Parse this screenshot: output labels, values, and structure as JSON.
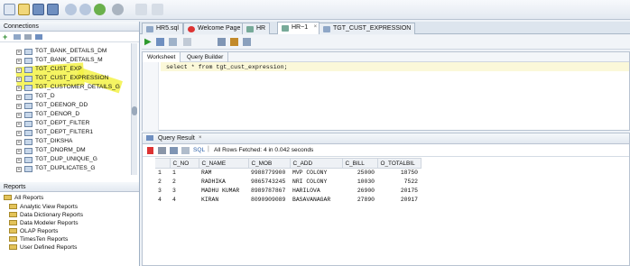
{
  "toolbar": {
    "icons": [
      "new-icon",
      "open-icon",
      "save-icon",
      "save-all-icon",
      "undo-icon",
      "redo-icon",
      "back-icon",
      "forward-icon",
      "run-icon",
      "debug-icon"
    ]
  },
  "tabs": [
    {
      "label": "HR5.sql",
      "color": "#8fa7c7"
    },
    {
      "label": "Welcome Page",
      "color": "#d33"
    },
    {
      "label": "HR",
      "color": "#7a9"
    },
    {
      "label": "HR~1",
      "color": "#7a9"
    },
    {
      "label": "TGT_CUST_EXPRESSION",
      "color": "#8fa7c7"
    }
  ],
  "connections": {
    "title": "Connections",
    "items": [
      "TGT_BANK_DETAILS_DM",
      "TGT_BANK_DETAILS_M",
      "TGT_CUST_EXP",
      "TGT_CUST_EXPRESSION",
      "TGT_CUSTOMER_DETAILS_G",
      "TGT_D",
      "TGT_DEENOR_DD",
      "TGT_DENOR_D",
      "TGT_DEPT_FILTER",
      "TGT_DEPT_FILTER1",
      "TGT_DIKSHA",
      "TGT_DNORM_DM",
      "TGT_DUP_UNIQUE_G",
      "TGT_DUPLICATES_G"
    ]
  },
  "reports": {
    "title": "Reports",
    "root": "All Reports",
    "items": [
      "Analytic View Reports",
      "Data Dictionary Reports",
      "Data Modeler Reports",
      "OLAP Reports",
      "TimesTen Reports",
      "User Defined Reports"
    ]
  },
  "worksheet": {
    "tabs": [
      "Worksheet",
      "Query Builder"
    ],
    "sql": "select * from tgt_cust_expression;"
  },
  "query_result": {
    "title": "Query Result",
    "sql_label": "SQL",
    "status": "All Rows Fetched: 4 in 0.042 seconds",
    "columns": [
      "C_NO",
      "C_NAME",
      "C_MOB",
      "C_ADD",
      "C_BILL",
      "O_TOTALBIL"
    ],
    "rows": [
      [
        "1",
        "1",
        "RAM",
        "9988779900",
        "MVP COLONY",
        "25000",
        "18750"
      ],
      [
        "2",
        "2",
        "RADHIKA",
        "9865743245",
        "NRI COLONY",
        "10030",
        "7522"
      ],
      [
        "3",
        "3",
        "MADHU KUMAR",
        "8989787867",
        "HARILOVA",
        "26900",
        "20175"
      ],
      [
        "4",
        "4",
        "KIRAN",
        "8090909089",
        "BASAVANAGAR",
        "27890",
        "20917"
      ]
    ]
  }
}
